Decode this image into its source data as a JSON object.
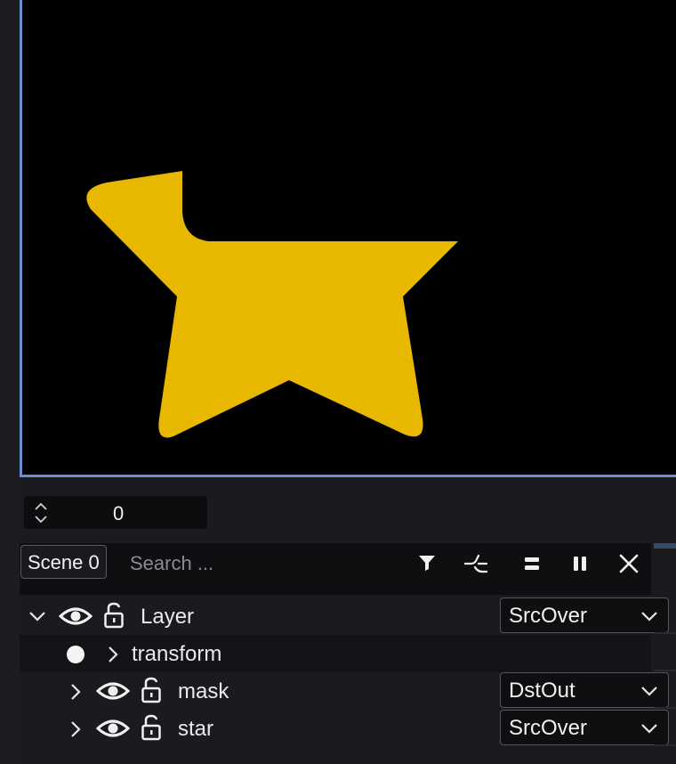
{
  "frame": {
    "value": "0"
  },
  "toolbar": {
    "scene_label": "Scene 0",
    "search_placeholder": "Search ..."
  },
  "layers": [
    {
      "name": "Layer",
      "blend": "SrcOver"
    },
    {
      "name": "transform"
    },
    {
      "name": "mask",
      "blend": "DstOut"
    },
    {
      "name": "star",
      "blend": "SrcOver"
    }
  ],
  "colors": {
    "viewport_border": "#6a8fd0",
    "shape_fill": "#e8b800"
  },
  "icons": [
    "chevron-up-icon",
    "chevron-down-icon",
    "filter-icon",
    "curve-icon",
    "equals-icon",
    "pause-icon",
    "close-icon",
    "eye-icon",
    "lock-icon",
    "dot-icon",
    "chevron-right-icon"
  ]
}
